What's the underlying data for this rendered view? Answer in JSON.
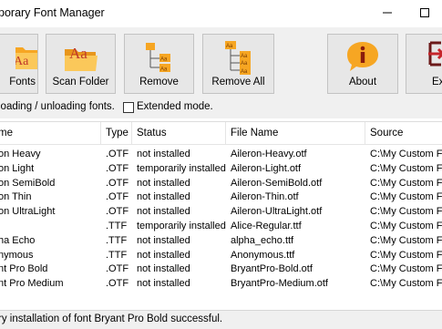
{
  "window": {
    "title": "porary Font Manager"
  },
  "toolbar": {
    "buttons": [
      {
        "label": "Fonts",
        "icon": "font-icon"
      },
      {
        "label": "Scan Folder",
        "icon": "folder-font-icon"
      },
      {
        "label": "Remove",
        "icon": "remove-tree-icon"
      },
      {
        "label": "Remove All",
        "icon": "remove-all-tree-icon"
      },
      {
        "label": "About",
        "icon": "info-icon"
      },
      {
        "label": "Ex",
        "icon": "exit-icon"
      }
    ]
  },
  "options": {
    "status_label": "loading / unloading fonts.",
    "extended_mode_label": "Extended mode.",
    "extended_mode_checked": false
  },
  "table": {
    "columns": [
      "me",
      "Type",
      "Status",
      "File Name",
      "Source"
    ],
    "rows": [
      [
        "on Heavy",
        ".OTF",
        "not installed",
        "Aileron-Heavy.otf",
        "C:\\My Custom Fon"
      ],
      [
        "on Light",
        ".OTF",
        "temporarily installed",
        "Aileron-Light.otf",
        "C:\\My Custom Fon"
      ],
      [
        "on SemiBold",
        ".OTF",
        "not installed",
        "Aileron-SemiBold.otf",
        "C:\\My Custom Fon"
      ],
      [
        "on Thin",
        ".OTF",
        "not installed",
        "Aileron-Thin.otf",
        "C:\\My Custom Fon"
      ],
      [
        "on UltraLight",
        ".OTF",
        "not installed",
        "Aileron-UltraLight.otf",
        "C:\\My Custom Fon"
      ],
      [
        "",
        ".TTF",
        "temporarily installed",
        "Alice-Regular.ttf",
        "C:\\My Custom Fon"
      ],
      [
        "ha Echo",
        ".TTF",
        "not installed",
        "alpha_echo.ttf",
        "C:\\My Custom Fon"
      ],
      [
        "nymous",
        ".TTF",
        "not installed",
        "Anonymous.ttf",
        "C:\\My Custom Fon"
      ],
      [
        "nt Pro Bold",
        ".OTF",
        "not installed",
        "BryantPro-Bold.otf",
        "C:\\My Custom Fon"
      ],
      [
        "nt Pro Medium",
        ".OTF",
        "not installed",
        "BryantPro-Medium.otf",
        "C:\\My Custom Fon"
      ]
    ]
  },
  "statusbar": {
    "text": "ry installation of font Bryant Pro Bold successful."
  },
  "colors": {
    "toolbar_bg": "#f0f0f0",
    "button_bg": "#e7e7e7",
    "icon_orange": "#f6a623",
    "exit_red": "#c6252b"
  }
}
